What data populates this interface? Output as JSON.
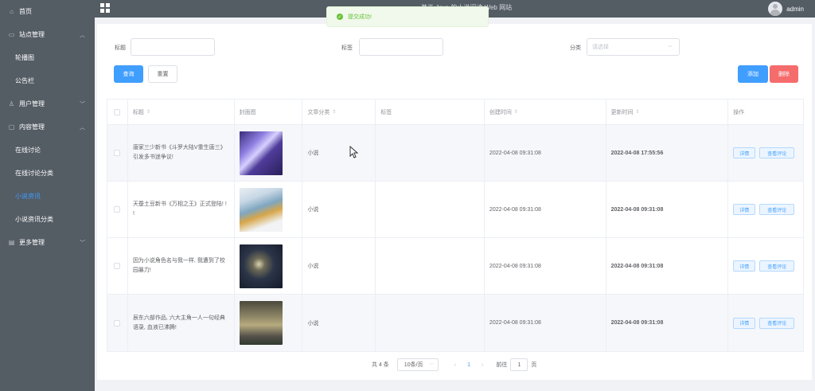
{
  "sidebar": {
    "items": [
      {
        "label": "首页",
        "icon": "home-icon"
      },
      {
        "label": "站点管理",
        "icon": "monitor-icon",
        "subs": [
          "轮播图",
          "公告栏"
        ]
      },
      {
        "label": "用户管理",
        "icon": "user-icon"
      },
      {
        "label": "内容管理",
        "icon": "chat-icon",
        "subs": [
          "在线讨论",
          "在线讨论分类",
          "小说资讯",
          "小说资讯分类"
        ]
      },
      {
        "label": "更多管理",
        "icon": "more-icon"
      }
    ],
    "active_sub": "小说资讯"
  },
  "topbar": {
    "title": "基于 Java 的小说阅读 Web 网站",
    "user": "admin"
  },
  "toast": {
    "text": "提交成功!",
    "color": "#67c23a"
  },
  "filters": {
    "title_label": "标题",
    "tag_label": "标签",
    "category_label": "分类",
    "category_placeholder": "请选择",
    "query_button": "查询",
    "reset_button": "重置",
    "add_button": "添加",
    "delete_button": "删除"
  },
  "table": {
    "columns": [
      "标题",
      "封面图",
      "文章分类",
      "标签",
      "创建时间",
      "更新时间",
      "操作"
    ],
    "rows": [
      {
        "title": "唐家三少新书《斗罗大陆V重生唐三》引发多书迷争议!",
        "category": "小说",
        "tag": "",
        "created": "2022-04-08 09:31:08",
        "updated": "2022-04-08 17:55:56",
        "cover": "cover-1"
      },
      {
        "title": "天蚕土豆新书《万相之王》正式登陆! ! !",
        "category": "小说",
        "tag": "",
        "created": "2022-04-08 09:31:08",
        "updated": "2022-04-08 09:31:08",
        "cover": "cover-2"
      },
      {
        "title": "因为小说角色名与我一样, 我遭到了校园暴力!",
        "category": "小说",
        "tag": "",
        "created": "2022-04-08 09:31:08",
        "updated": "2022-04-08 09:31:08",
        "cover": "cover-3"
      },
      {
        "title": "辰东六部作品, 六大主角一人一句经典语录, 血液已沸腾!",
        "category": "小说",
        "tag": "",
        "created": "2022-04-08 09:31:08",
        "updated": "2022-04-08 09:31:08",
        "cover": "cover-4"
      }
    ],
    "op_detail": "详情",
    "op_comments": "查看评论"
  },
  "pagination": {
    "total": "共 4 条",
    "page_size": "10条/页",
    "current": "1",
    "goto_prefix": "前往",
    "goto_value": "1",
    "goto_suffix": "页"
  },
  "colors": {
    "sidebar_bg": "#545c64",
    "primary": "#409eff",
    "danger": "#f56c6c"
  }
}
